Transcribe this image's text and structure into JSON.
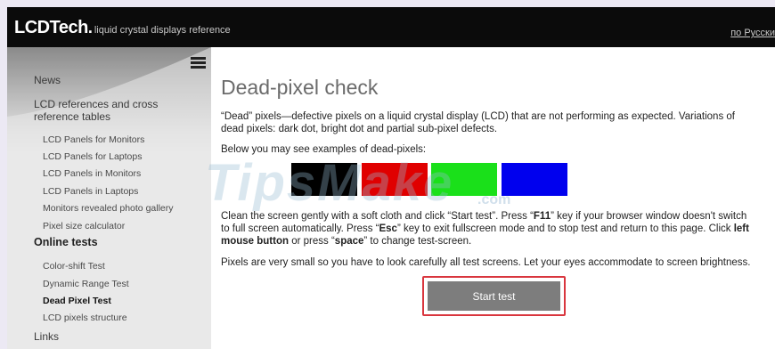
{
  "header": {
    "logo_main": "LCDTech",
    "logo_dot": ".",
    "logo_sub": "liquid crystal displays reference",
    "lang_link": "по Русски"
  },
  "sidebar": {
    "top_items": [
      "News",
      "LCD references and cross",
      "reference tables"
    ],
    "sub_items": [
      "LCD Panels for Monitors",
      "LCD Panels for Laptops",
      "LCD Panels in Monitors",
      "LCD Panels in Laptops",
      "Monitors revealed photo gallery",
      "Pixel size calculator"
    ],
    "online_heading": "Online tests",
    "test_items": [
      "Color-shift Test",
      "Dynamic Range Test",
      "Dead Pixel Test",
      "LCD pixels structure"
    ],
    "links": "Links"
  },
  "main": {
    "title": "Dead-pixel check",
    "intro_l1": "“Dead” pixels—defective pixels on a liquid crystal display (LCD) that are not performing as expected. Variations of",
    "intro_l2": "dead pixels: dark dot, bright dot and partial sub-pixel defects.",
    "examples": "Below you may see examples of dead-pixels:",
    "clean_l1_a": "Clean the screen gently with a soft cloth and click “Start test”. Press “",
    "key_f11": "F11",
    "clean_l1_b": "” key if your browser window doesn't switch",
    "clean_l2_a": "to full screen automatically. Press “",
    "key_esc": "Esc",
    "clean_l2_b": "” key to exit fullscreen mode and to stop test and return to this page. Click ",
    "key_left": "left",
    "key_mouse": "mouse button",
    "clean_l3_b": " or press “",
    "key_space": "space",
    "clean_l3_c": "” to change test-screen.",
    "pixels_note": "Pixels are very small so you have to look carefully all test screens. Let your eyes accommodate to screen brightness.",
    "start_button": "Start test"
  },
  "swatches": [
    "#000000",
    "#e00000",
    "#1ae01a",
    "#0000ee"
  ],
  "watermark": {
    "text": "TipsMake",
    "suffix": ".com"
  }
}
